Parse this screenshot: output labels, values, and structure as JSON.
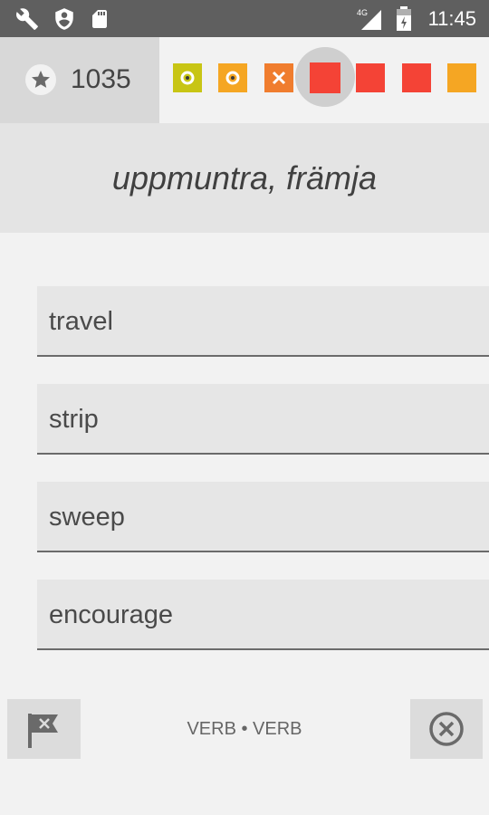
{
  "status_bar": {
    "time": "11:45",
    "network": "4G",
    "icons": [
      "wrench-icon",
      "shield-icon",
      "sd-card-icon",
      "signal-icon",
      "battery-icon"
    ]
  },
  "score": {
    "value": "1035",
    "icon": "star-icon"
  },
  "progress": [
    {
      "status": "correct",
      "color": "#c8c514"
    },
    {
      "status": "correct",
      "color": "#f5a623"
    },
    {
      "status": "wrong",
      "color": "#f07d2e"
    },
    {
      "status": "current",
      "color": "#f44336"
    },
    {
      "status": "pending",
      "color": "#f44336"
    },
    {
      "status": "pending",
      "color": "#f44336"
    },
    {
      "status": "pending",
      "color": "#f5a623"
    }
  ],
  "prompt": {
    "word": "uppmuntra, främja"
  },
  "options": [
    {
      "label": "travel"
    },
    {
      "label": "strip"
    },
    {
      "label": "sweep"
    },
    {
      "label": "encourage"
    }
  ],
  "footer": {
    "part_of_speech": "VERB • VERB",
    "flag_icon": "flag-icon",
    "close_icon": "close-circle-icon"
  }
}
